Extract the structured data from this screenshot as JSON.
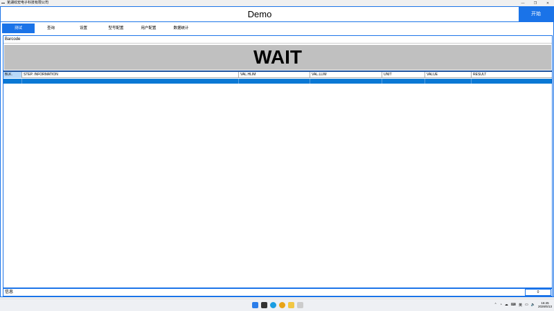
{
  "window": {
    "title": "芜湖纹宏电子科技有限公司",
    "minimize_glyph": "—",
    "maximize_glyph": "❐",
    "close_glyph": "✕"
  },
  "header": {
    "title": "Demo",
    "start_label": "开始"
  },
  "tabs": [
    {
      "label": "测试",
      "active": true
    },
    {
      "label": "查询"
    },
    {
      "label": "设置"
    },
    {
      "label": "型号配置"
    },
    {
      "label": "用户配置"
    },
    {
      "label": "数据统计"
    }
  ],
  "barcode_label": "Barcode",
  "status_banner": "WAIT",
  "table": {
    "columns": [
      "BLK.",
      "STEP. INFORMATION",
      "VAL.HLIM",
      "VAL.LLIM",
      "UNIT",
      "VALUE",
      "RESULT"
    ],
    "selected_row_index": 0
  },
  "status_bar": {
    "info_label": "信息",
    "count": "0"
  },
  "taskbar": {
    "time": "16:45",
    "date": "2026/5/13",
    "ime": "英"
  },
  "colors": {
    "accent": "#1a73e8",
    "wait_bg": "#c0c0c0",
    "selected_row": "#0a78d4"
  }
}
